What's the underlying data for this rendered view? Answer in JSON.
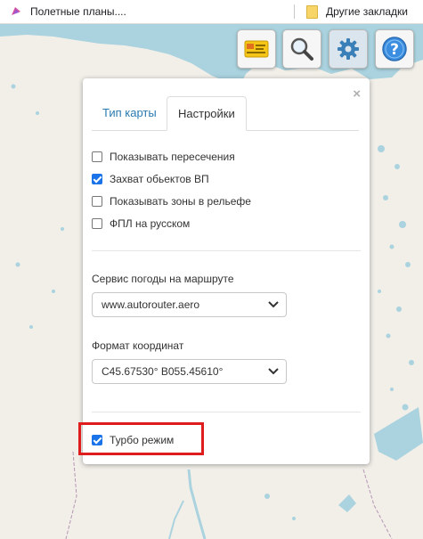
{
  "bookmarks": {
    "left_label": "Полетные планы....",
    "right_label": "Другие закладки",
    "left_icon": "flight-plan-icon",
    "right_icon": "folder-icon"
  },
  "toolbar": {
    "buttons": [
      {
        "name": "map-layers-button",
        "icon": "ticket-card-icon"
      },
      {
        "name": "search-button",
        "icon": "magnifier-icon"
      },
      {
        "name": "settings-button",
        "icon": "gear-icon",
        "active": true
      },
      {
        "name": "help-button",
        "icon": "help-icon"
      }
    ]
  },
  "panel": {
    "close_label": "×",
    "tabs": [
      {
        "label": "Тип карты",
        "active": false
      },
      {
        "label": "Настройки",
        "active": true
      }
    ],
    "options": [
      {
        "label": "Показывать пересечения",
        "checked": false
      },
      {
        "label": "Захват обьектов ВП",
        "checked": true
      },
      {
        "label": "Показывать зоны в рельефе",
        "checked": false
      },
      {
        "label": "ФПЛ на русском",
        "checked": false
      }
    ],
    "weather": {
      "label": "Сервис погоды на маршруте",
      "value": "www.autorouter.aero"
    },
    "coords": {
      "label": "Формат координат",
      "value": "С45.67530° В055.45610°"
    },
    "turbo": {
      "label": "Турбо режим",
      "checked": true
    }
  },
  "colors": {
    "accent": "#1a73e8",
    "tab_link": "#2a7ab0",
    "highlight": "#e01d1d",
    "water": "#aad3df",
    "land": "#f2efe9"
  }
}
